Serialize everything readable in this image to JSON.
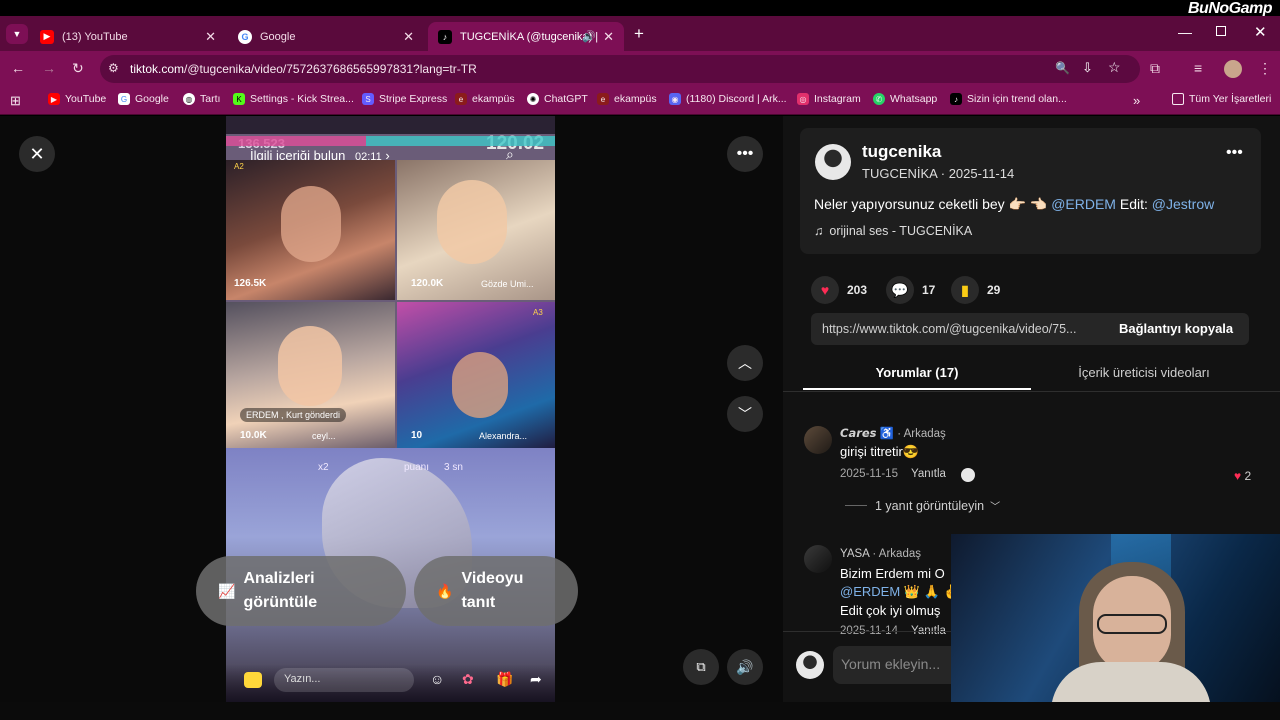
{
  "stream_logo": "BuNoGamp",
  "tabs": [
    {
      "label": "(13) YouTube",
      "icon": "youtube-icon"
    },
    {
      "label": "Google",
      "icon": "google-icon"
    },
    {
      "label": "TUGCENİKA (@tugcenika) |",
      "icon": "tiktok-icon"
    }
  ],
  "address": {
    "url_host": "tiktok.com",
    "url_rest": "/@tugcenika/video/7572637686565997831?lang=tr-TR"
  },
  "bookmarks": [
    {
      "label": "YouTube",
      "color": "#ff0000"
    },
    {
      "label": "Google",
      "color": "#ffffff"
    },
    {
      "label": "Tartı",
      "color": "#ffffff"
    },
    {
      "label": "Settings - Kick Strea...",
      "color": "#53fc18"
    },
    {
      "label": "Stripe Express",
      "color": "#635bff"
    },
    {
      "label": "ekampüs",
      "color": "#8b1b1b"
    },
    {
      "label": "ChatGPT",
      "color": "#ffffff"
    },
    {
      "label": "ekampüs",
      "color": "#8b1b1b"
    },
    {
      "label": "(1180) Discord | Ark...",
      "color": "#5865f2"
    },
    {
      "label": "Instagram",
      "color": "#e1306c"
    },
    {
      "label": "Whatsapp",
      "color": "#25d366"
    },
    {
      "label": "Sizin için trend olan...",
      "color": "#000000"
    }
  ],
  "all_bookmarks": "Tüm Yer İşaretleri",
  "video": {
    "search_hint": "İlgili içeriği bulun",
    "search_time": "02:11",
    "top_count": "136.523",
    "top_right_num": "120.02",
    "cells": [
      {
        "count": "126.5K",
        "label": ""
      },
      {
        "count": "120.0K",
        "label": "Gözde Umi..."
      },
      {
        "count": "10.0K",
        "label": "ceyl..."
      },
      {
        "count": "10",
        "label": "Alexandra..."
      }
    ],
    "gift_text": "ERDEM , Kurt  gönderdi",
    "points_text": "puanı",
    "points_time": "3 sn",
    "x2": "x2",
    "badge_a2": "A2",
    "badge_a3": "A3",
    "chat_placeholder": "Yazın..."
  },
  "buttons": {
    "analytics": "Analizleri görüntüle",
    "promote": "Videoyu tanıt"
  },
  "author": {
    "username": "tugcenika",
    "display": "TUGCENİKA",
    "date": "2025-11-14",
    "caption_text": "Neler yapıyorsunuz ceketli bey 👉🏻 👈🏻",
    "mention1": "@ERDEM",
    "caption_mid": "Edit:",
    "mention2": "@Jestrow",
    "music": "orijinal ses - TUGCENİKA"
  },
  "stats": {
    "likes": "203",
    "comments": "17",
    "saves": "29"
  },
  "link": {
    "url": "https://www.tiktok.com/@tugcenika/video/75...",
    "copy": "Bağlantıyı kopyala"
  },
  "panel_tabs": {
    "comments": "Yorumlar (17)",
    "creator": "İçerik üreticisi videoları"
  },
  "comments": [
    {
      "name": "𝘾𝙖𝙧𝙚𝙨 ♿",
      "relation": "Arkadaş",
      "text": "girişi titretir😎",
      "date": "2025-11-15",
      "reply": "Yanıtla",
      "likes": "2",
      "view_replies": "1 yanıt görüntüleyin"
    },
    {
      "name": "YASA",
      "relation": "Arkadaş",
      "text1": "Bizim Erdem mi O",
      "mention": "@ERDEM",
      "text2": "👑 🙏 ✌",
      "text3": "Edit çok iyi olmuş",
      "date": "2025-11-14",
      "reply": "Yanıtla"
    }
  ],
  "add_comment": "Yorum ekleyin..."
}
